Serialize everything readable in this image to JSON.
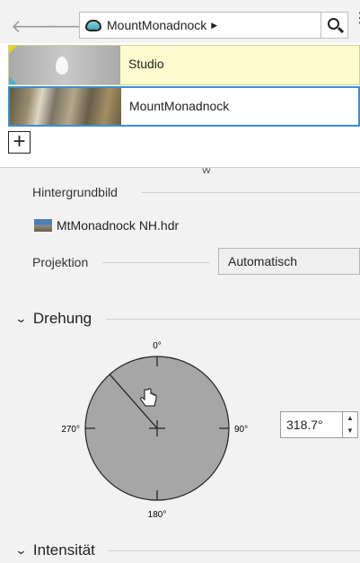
{
  "breadcrumb": {
    "label": "MountMonadnock"
  },
  "environments": [
    {
      "name": "Studio"
    },
    {
      "name": "MountMonadnock"
    }
  ],
  "add_button": {
    "label": "+"
  },
  "properties": {
    "background_label": "Hintergrundbild",
    "background_file": "MtMonadnock NH.hdr",
    "projection_label": "Projektion",
    "projection_value": "Automatisch"
  },
  "rotation": {
    "section_title": "Drehung",
    "angle_value": "318.7°",
    "angle_degrees": 318.7,
    "labels": {
      "top": "0°",
      "right": "90°",
      "bottom": "180°",
      "left": "270°"
    }
  },
  "intensity": {
    "section_title": "Intensität"
  },
  "icons": {
    "back": "arrow-left-icon",
    "forward": "arrow-right-icon",
    "search": "search-icon",
    "more": "more-vertical-icon",
    "collapse": "chevron-down-icon",
    "cursor": "hand-cursor-icon"
  },
  "colors": {
    "selection_border": "#3b8fd0",
    "studio_highlight": "#fdfbcd",
    "dial_fill": "#a6a6a6"
  }
}
